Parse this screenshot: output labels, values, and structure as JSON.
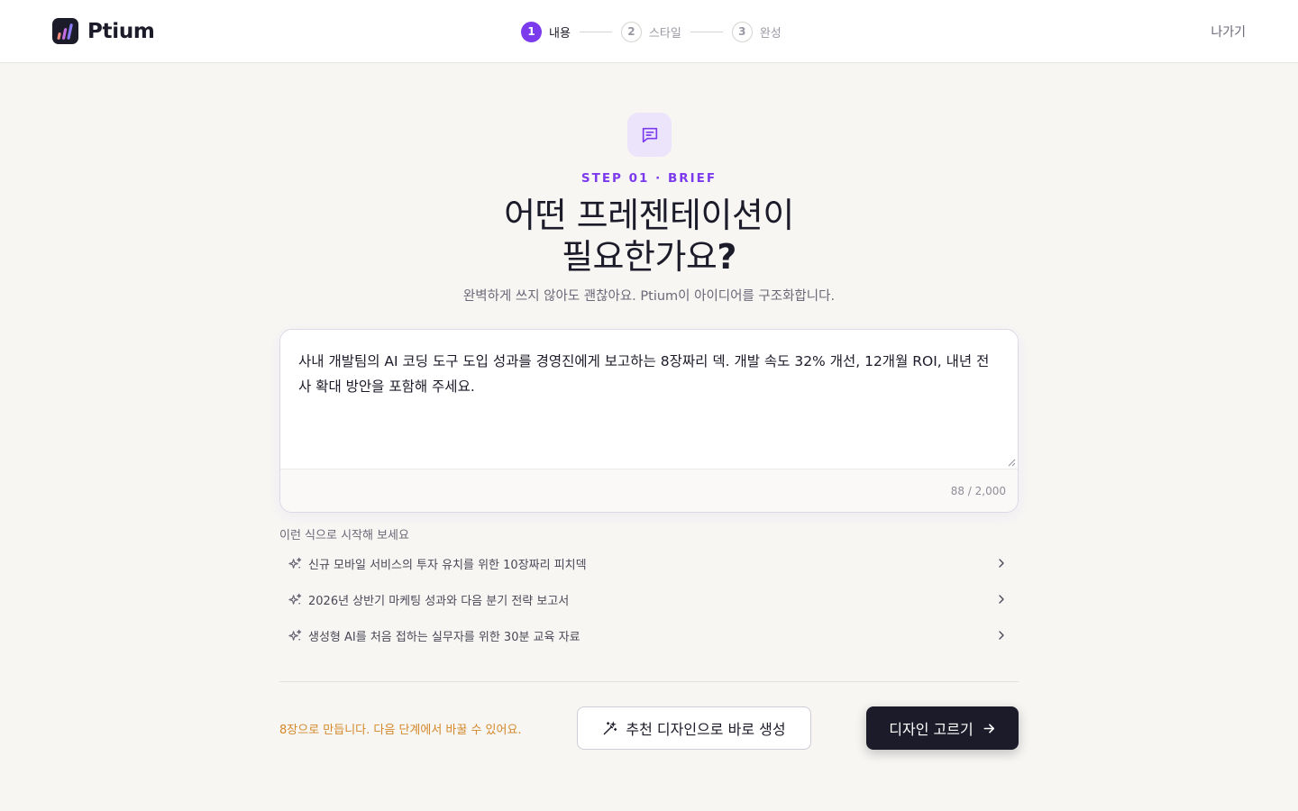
{
  "app": {
    "name": "Ptium"
  },
  "stepper": {
    "steps": [
      {
        "num": "1",
        "label": "내용",
        "state": "active"
      },
      {
        "num": "2",
        "label": "스타일",
        "state": "inactive"
      },
      {
        "num": "3",
        "label": "완성",
        "state": "inactive"
      }
    ]
  },
  "header": {
    "exit_label": "나가기"
  },
  "hero": {
    "icon": "message-square-icon",
    "step_tag": "STEP 01 · BRIEF",
    "title_line1": "어떤 프레젠테이션이",
    "title_line2": "필요한가요",
    "title_mark": "?",
    "subtitle": "완벽하게 쓰지 않아도 괜찮아요. Ptium이 아이디어를 구조화합니다."
  },
  "brief": {
    "value": "사내 개발팀의 AI 코딩 도구 도입 성과를 경영진에게 보고하는 8장짜리 덱. 개발 속도 32% 개선, 12개월 ROI, 내년 전사 확대 방안을 포함해 주세요.",
    "char_count": "88 / 2,000"
  },
  "suggestions": {
    "title": "이런 식으로 시작해 보세요",
    "items": [
      {
        "text": "신규 모바일 서비스의 투자 유치를 위한 10장짜리 피치덱"
      },
      {
        "text": "2026년 상반기 마케팅 성과와 다음 분기 전략 보고서"
      },
      {
        "text": "생성형 AI를 처음 접하는 실무자를 위한 30분 교육 자료"
      }
    ]
  },
  "footer": {
    "note": "8장으로 만듭니다. 다음 단계에서 바꿀 수 있어요.",
    "quick_button": "추천 디자인으로 바로 생성",
    "primary_button": "디자인 고르기"
  },
  "colors": {
    "accent": "#7c3aed",
    "dark": "#1c1b29",
    "note": "#d4882a",
    "background": "#f7f6f3"
  }
}
